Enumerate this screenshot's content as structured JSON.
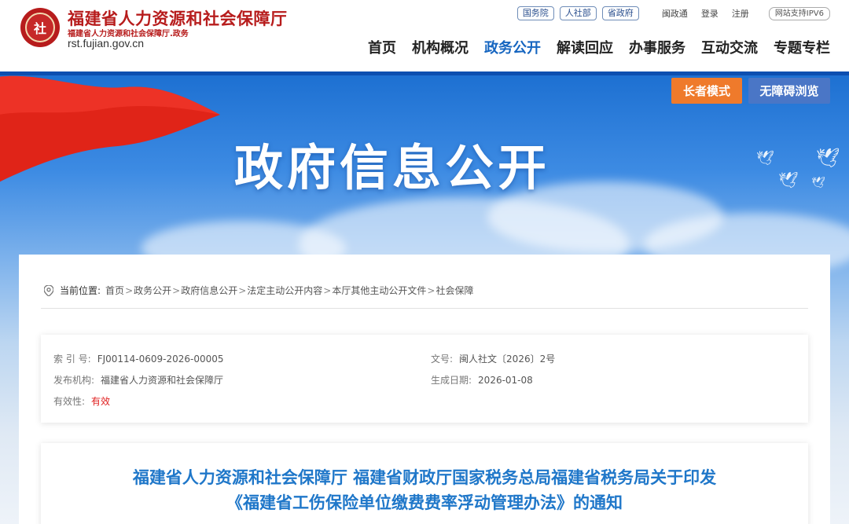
{
  "header": {
    "org_name": "福建省人力资源和社会保障厅",
    "org_sub": "福建省人力资源和社会保障厅.政务",
    "url": "rst.fujian.gov.cn",
    "logo_text": "社",
    "top_tags": [
      "国务院",
      "人社部",
      "省政府"
    ],
    "top_links": [
      "闽政通",
      "登录",
      "注册"
    ],
    "ipv6": "网站支持IPV6",
    "nav": [
      "首页",
      "机构概况",
      "政务公开",
      "解读回应",
      "办事服务",
      "互动交流",
      "专题专栏"
    ],
    "nav_active": "政务公开"
  },
  "banner": {
    "title": "政府信息公开",
    "elder_mode": "长者模式",
    "accessible": "无障碍浏览"
  },
  "breadcrumb": {
    "label": "当前位置:",
    "items": [
      "首页",
      "政务公开",
      "政府信息公开",
      "法定主动公开内容",
      "本厅其他主动公开文件",
      "社会保障"
    ],
    "separator": ">"
  },
  "meta": {
    "index_label": "索 引 号:",
    "index_value": "FJ00114-0609-2026-00005",
    "doc_no_label": "文号:",
    "doc_no_value": "闽人社文〔2026〕2号",
    "publisher_label": "发布机构:",
    "publisher_value": "福建省人力资源和社会保障厅",
    "date_label": "生成日期:",
    "date_value": "2026-01-08",
    "validity_label": "有效性:",
    "validity_value": "有效"
  },
  "document": {
    "title_line1": "福建省人力资源和社会保障厅 福建省财政厅国家税务总局福建省税务局关于印发",
    "title_line2": "《福建省工伤保险单位缴费费率浮动管理办法》的通知"
  },
  "colors": {
    "brand_red": "#b71c1c",
    "nav_active": "#1565c0",
    "title_blue": "#1f77c9",
    "elder_btn": "#ef7a2b",
    "access_btn": "#4a76c6",
    "valid_red": "#e02020"
  }
}
